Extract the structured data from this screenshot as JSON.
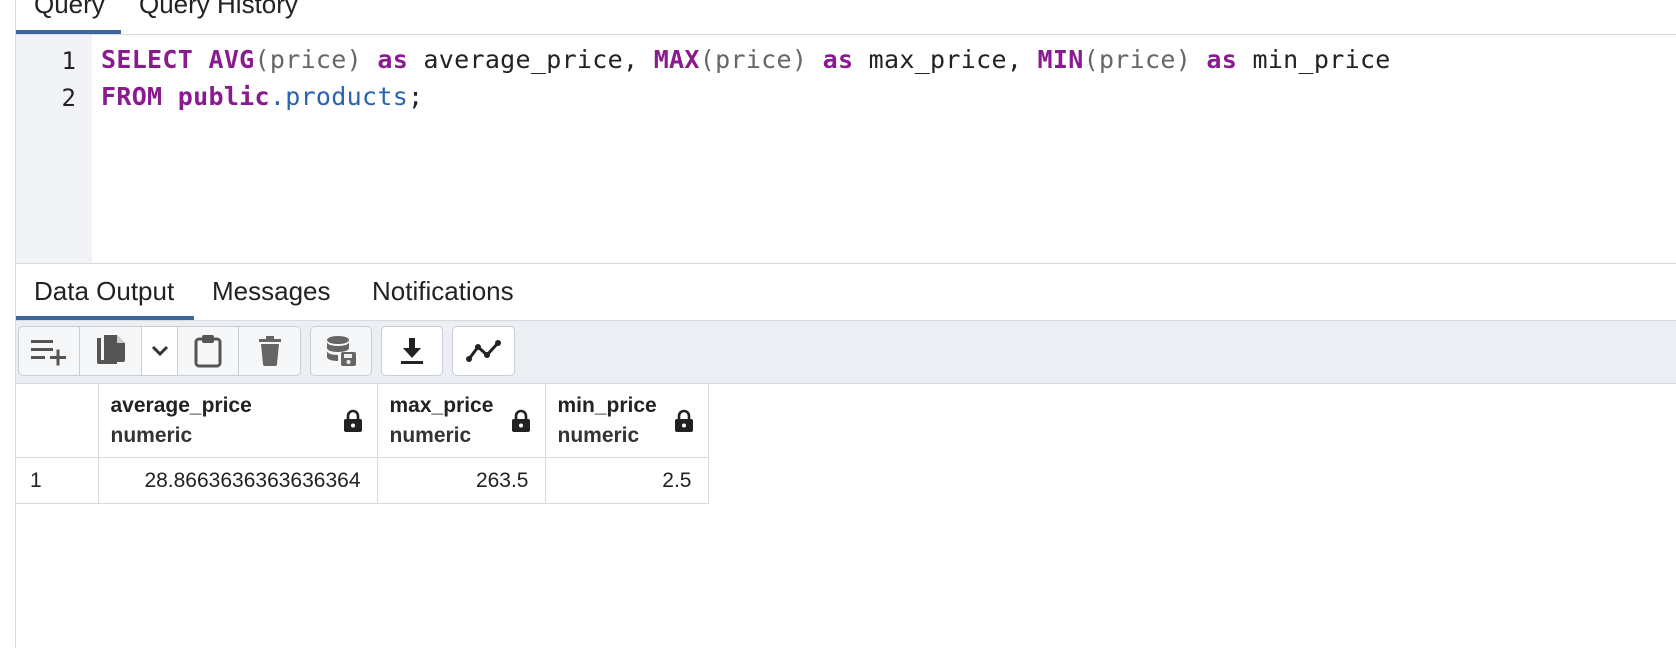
{
  "query_tabs": [
    {
      "label": "Query",
      "active": true
    },
    {
      "label": "Query History",
      "active": false
    }
  ],
  "editor": {
    "line_numbers": [
      "1",
      "2"
    ],
    "line1": {
      "t1": "SELECT",
      "t2": "AVG",
      "t3": "(price)",
      "t4": "as",
      "t5": "average_price,",
      "t6": "MAX",
      "t7": "(price)",
      "t8": "as",
      "t9": "max_price,",
      "t10": "MIN",
      "t11": "(price)",
      "t12": "as",
      "t13": "min_price"
    },
    "line2": {
      "t1": "FROM",
      "t2": "public",
      "t3": ".",
      "t4": "products",
      "t5": ";"
    }
  },
  "output_tabs": [
    {
      "label": "Data Output",
      "active": true
    },
    {
      "label": "Messages",
      "active": false
    },
    {
      "label": "Notifications",
      "active": false
    }
  ],
  "toolbar": {
    "icons": [
      "add-row-icon",
      "copy-icon",
      "chevron-down-icon",
      "paste-icon",
      "delete-icon",
      "save-data-icon",
      "download-icon",
      "graph-visualiser-icon"
    ]
  },
  "results": {
    "columns": [
      {
        "name": "average_price",
        "type": "numeric"
      },
      {
        "name": "max_price",
        "type": "numeric"
      },
      {
        "name": "min_price",
        "type": "numeric"
      }
    ],
    "rows": [
      {
        "num": "1",
        "values": [
          "28.8663636363636364",
          "263.5",
          "2.5"
        ]
      }
    ]
  },
  "colors": {
    "accent": "#3e6699",
    "keyword": "#8a1a8f",
    "identifier": "#2a64b0"
  }
}
